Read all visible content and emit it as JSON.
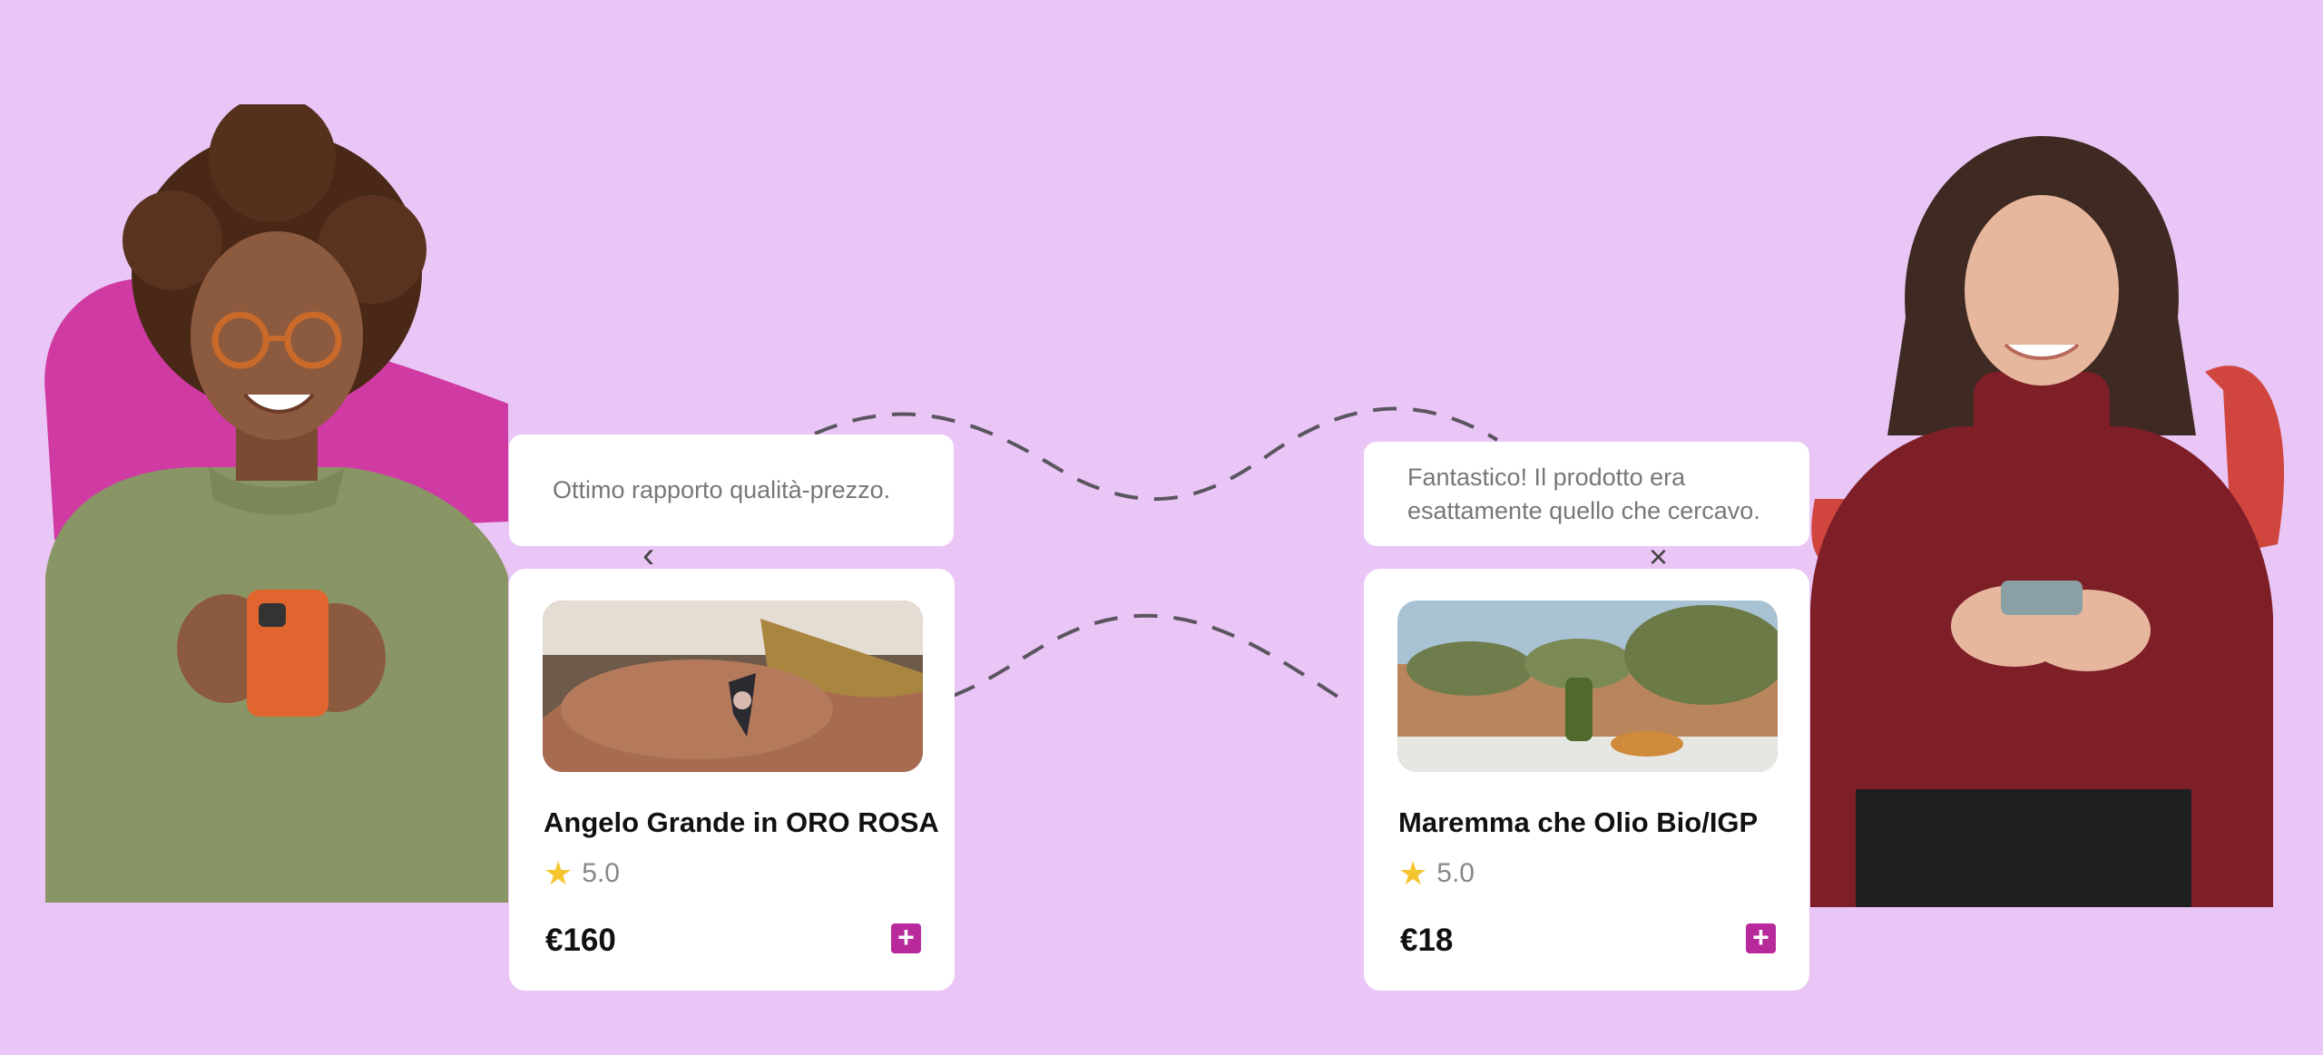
{
  "page": {
    "background": "#e9c6f5",
    "accent": "#b82a9c",
    "star_color": "#f5c530"
  },
  "reviews": [
    {
      "text": "Ottimo rapporto qualità-prezzo."
    },
    {
      "text": "Fantastico! Il prodotto era esattamente quello che cercavo."
    }
  ],
  "products": [
    {
      "title": "Angelo Grande in ORO ROSA",
      "rating": "5.0",
      "price": "€160",
      "add_label": "+",
      "star": "★"
    },
    {
      "title": "Maremma che Olio Bio/IGP",
      "rating": "5.0",
      "price": "€18",
      "add_label": "+",
      "star": "★"
    }
  ],
  "carousel": {
    "prev_icon": "‹",
    "close_icon": "×"
  },
  "icons": [
    "star-icon",
    "plus-icon",
    "chevron-left-icon",
    "close-icon"
  ]
}
